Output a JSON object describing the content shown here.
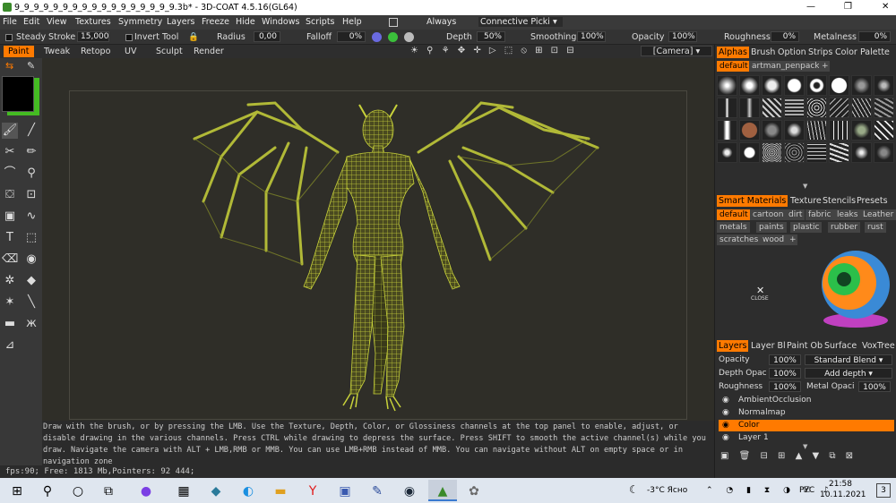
{
  "window": {
    "title": "9_9_9_9_9_9_9_9_9_9_9_9_9_9_9_9_9.3b* - 3D-COAT 4.5.16(GL64)",
    "minimize": "—",
    "maximize": "❐",
    "close": "✕"
  },
  "menu": [
    "File",
    "Edit",
    "View",
    "Textures",
    "Symmetry",
    "Layers",
    "Freeze",
    "Hide",
    "Windows",
    "Scripts",
    "Help"
  ],
  "menu_extra": {
    "always": "Always",
    "connective": "Connective Picki"
  },
  "toolbar": {
    "steady_label": "Steady",
    "stroke_label": "Stroke",
    "stroke_value": "15,000",
    "invert_tool": "Invert Tool",
    "radius_label": "Radius",
    "radius_value": "0,00",
    "falloff_label": "Falloff",
    "falloff_value": "0%",
    "depth_label": "Depth",
    "depth_value": "50%",
    "smoothing_label": "Smoothing",
    "smoothing_value": "100%",
    "opacity_label": "Opacity",
    "opacity_value": "100%",
    "roughness_label": "Roughness",
    "roughness_value": "0%",
    "metalness_label": "Metalness",
    "metalness_value": "0%"
  },
  "room_tabs": [
    "Paint",
    "Tweak",
    "Retopo",
    "UV",
    "Sculpt",
    "Render"
  ],
  "camera_label": "[Camera]",
  "hint_text": "Draw with the brush, or by pressing the LMB. Use the Texture, Depth, Color, or Glossiness channels at the top panel to enable, adjust, or disable drawing in the various channels. Press CTRL while drawing to depress the surface. Press SHIFT to smooth the active channel(s) while you draw. Navigate the camera with ALT + LMB,RMB or MMB. You can use LMB+RMB instead of MMB. You can navigate without ALT on empty space or in navigation zone",
  "status_text": "fps:90;    Free: 1813 Mb,Pointers: 92 444;",
  "right_panel": {
    "top_tabs": [
      "Alphas",
      "Brush",
      "Option",
      "Strips",
      "Color",
      "Palette"
    ],
    "alpha_chips": [
      "default",
      "artman_penpack"
    ],
    "smart_tabs": [
      "Smart Materials",
      "Texture",
      "Stencils",
      "Presets"
    ],
    "material_chips": [
      "default",
      "cartoon",
      "dirt",
      "fabric",
      "leaks",
      "Leather",
      "metals",
      "paints",
      "plastic",
      "rubber",
      "rust",
      "scratches",
      "wood"
    ],
    "close_label": "CLOSE",
    "layer_tabs": [
      "Layers",
      "Layer Bl",
      "Paint Ob",
      "Surface",
      "VoxTree"
    ],
    "opacity_label": "Opacity",
    "opacity_value": "100%",
    "blend_mode": "Standard Blend",
    "depth_opacity_label": "Depth Opac",
    "depth_opacity_value": "100%",
    "depth_mode": "Add depth",
    "roughness_label": "Roughness",
    "roughness_value": "100%",
    "metal_opacity_label": "Metal Opaci",
    "metal_opacity_value": "100%",
    "layers": [
      "AmbientOcclusion",
      "Normalmap",
      "Color",
      "Layer 1"
    ],
    "active_layer": "Color"
  },
  "taskbar": {
    "weather": "-3°C  Ясно",
    "lang": "РУС",
    "time": "21:58",
    "date": "10.11.2021",
    "notifications": "3"
  },
  "colors": {
    "accent": "#ff7a00",
    "primary_color": "#000000",
    "secondary_color": "#44bb22",
    "wire": "#c8d23a"
  }
}
